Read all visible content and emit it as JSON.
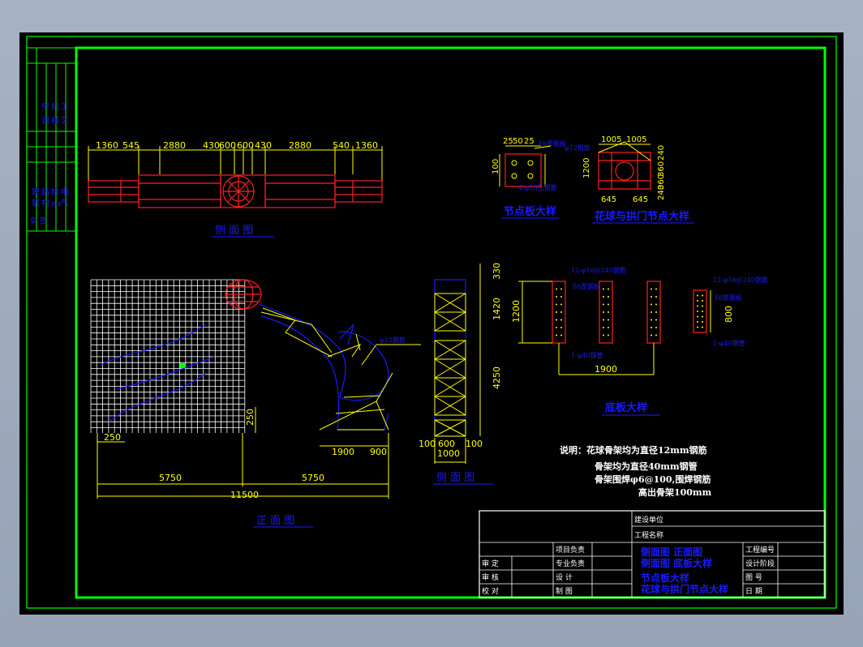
{
  "colors": {
    "frame": "#00ff00",
    "dim": "#ffff00",
    "red": "#ff2020",
    "blue": "#1a1aff",
    "title_text": "#1a1aff",
    "grid": "#ffffff"
  },
  "left_strip": {
    "col1": [
      "空",
      "调"
    ],
    "col2": [
      "机",
      "械"
    ],
    "col3": [
      "工",
      "艺"
    ],
    "col4": [
      "建",
      "筑"
    ],
    "col5": [
      "结",
      "构"
    ],
    "col6": [
      "给",
      "排水"
    ],
    "col7": [
      "电",
      "气"
    ],
    "sign": "会 签"
  },
  "side_view": {
    "dims": [
      "1360",
      "545",
      "2880",
      "430",
      "600",
      "600",
      "430",
      "2880",
      "540",
      "1360"
    ],
    "title": "侧 面 图"
  },
  "node_plate": {
    "title": "节点板大样",
    "dims": [
      "25",
      "50",
      "25",
      "100",
      "25",
      "50",
      "25"
    ],
    "label1": "δ8厚钢板",
    "label2": "4-φ16孔钢筋"
  },
  "gate_node": {
    "title": "花球与拱门节点大样",
    "dims_top": [
      "1005",
      "1005"
    ],
    "dims_side": [
      "1200",
      "240",
      "360",
      "360",
      "240"
    ],
    "dims_bottom": [
      "645",
      "645"
    ],
    "label": "φ12钢筋"
  },
  "front_view": {
    "title": "正 面 图",
    "dims": [
      "250",
      "250",
      "1900",
      "900",
      "5750",
      "5750",
      "11500"
    ],
    "label": "φ12钢筋"
  },
  "side_elev": {
    "title": "侧 面 图",
    "dims": [
      "330",
      "1420",
      "4250",
      "100",
      "600",
      "100",
      "1000"
    ]
  },
  "base_plate": {
    "title": "底板大样",
    "dims": [
      "1200",
      "1900",
      "800"
    ],
    "label1": "12-φ16@240钢筋",
    "label2": "δ8厚钢板",
    "label3": "1-φ40钢管"
  },
  "notes": {
    "line1": "说明：花球骨架均为直径12mm钢筋",
    "line2": "骨架均为直径40mm钢管",
    "line3": "骨架围焊φ6@100,围焊钢筋",
    "line4": "高出骨架100mm"
  },
  "title_block": {
    "unit_label": "建设单位",
    "project_label": "工程名称",
    "project_head": "项目负责",
    "prof_head": "专业负责",
    "design": "设    计",
    "drawing": "制    图",
    "approve": "审    定",
    "review": "审    核",
    "check": "校    对",
    "contents1": "侧面图    正面图",
    "contents2": "侧面图    底板大样",
    "contents3": "节点板大样",
    "contents4": "花球与拱门节点大样",
    "proj_no": "工程编号",
    "stage": "设计阶段",
    "drawing_no": "图    号",
    "date": "日    期"
  }
}
